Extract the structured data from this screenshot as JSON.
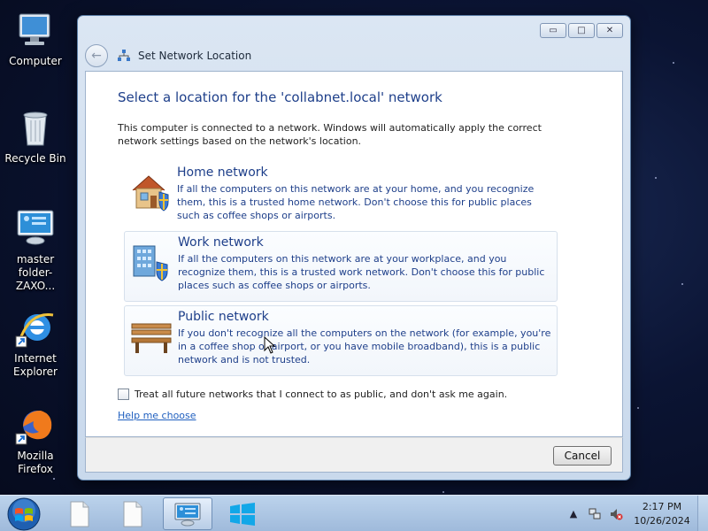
{
  "desktop": {
    "icons": [
      {
        "label": "Computer"
      },
      {
        "label": "Recycle Bin"
      },
      {
        "label": "master folder-ZAXO..."
      },
      {
        "label": "Internet Explorer"
      },
      {
        "label": "Mozilla Firefox"
      }
    ]
  },
  "window": {
    "title": "Set Network Location",
    "controls": {
      "minimize": "▭",
      "maximize": "□",
      "close": "✕"
    },
    "heading": "Select a location for the 'collabnet.local' network",
    "intro": "This computer is connected to a network. Windows will automatically apply the correct network settings based on the network's location.",
    "options": [
      {
        "title": "Home network",
        "description": "If all the computers on this network are at your home, and you recognize them, this is a trusted home network.  Don't choose this for public places such as coffee shops or airports."
      },
      {
        "title": "Work network",
        "description": "If all the computers on this network are at your workplace, and you recognize them, this is a trusted work network.  Don't choose this for public places such as coffee shops or airports."
      },
      {
        "title": "Public network",
        "description": "If you don't recognize all the computers on the network (for example, you're in a coffee shop or airport, or you have mobile broadband), this is a public network and is not trusted."
      }
    ],
    "checkbox_label": "Treat all future networks that I connect to as public, and don't ask me again.",
    "help_link": "Help me choose",
    "cancel_label": "Cancel"
  },
  "taskbar": {
    "clock_time": "2:17 PM",
    "clock_date": "10/26/2024"
  },
  "colors": {
    "heading": "#1e3f8a",
    "link": "#1f5fbf"
  }
}
